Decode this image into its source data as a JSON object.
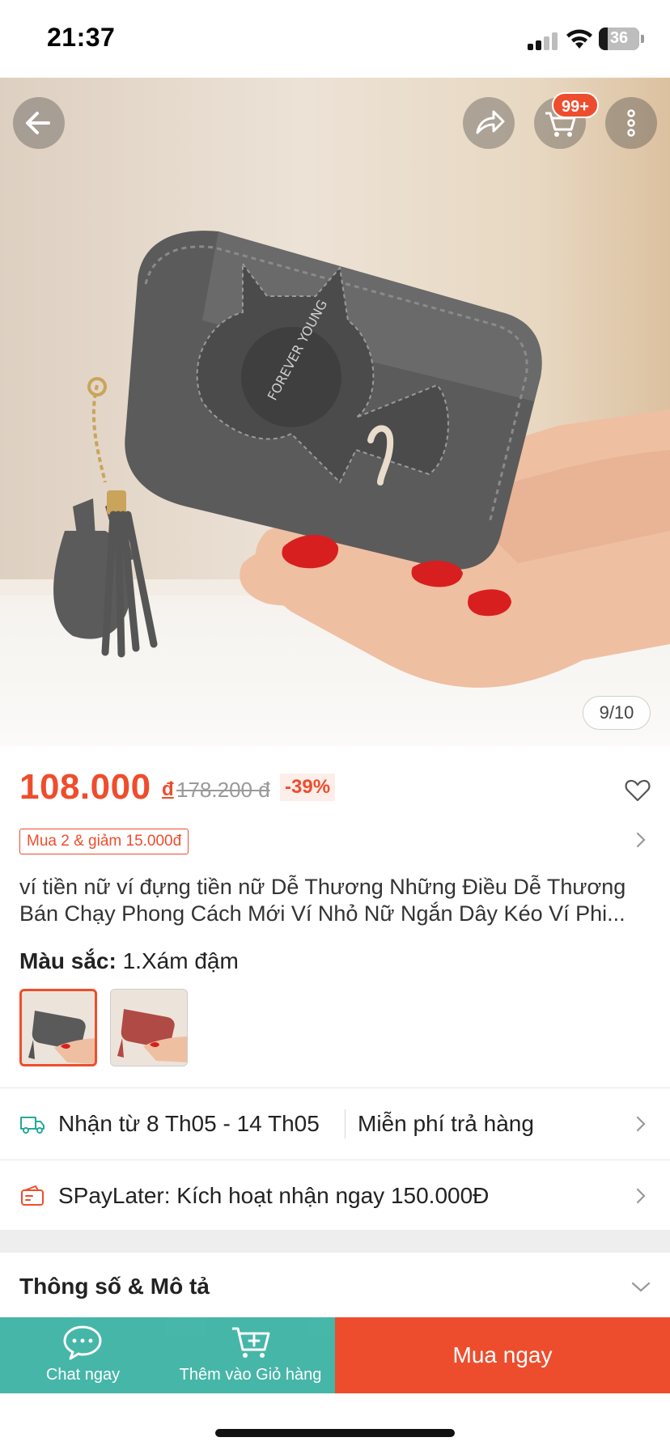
{
  "status_bar": {
    "time": "21:37",
    "battery": "36"
  },
  "product_image": {
    "counter": "9/10",
    "cart_badge": "99+",
    "icons": [
      "back-arrow-icon",
      "share-icon",
      "cart-icon",
      "more-vertical-icon"
    ]
  },
  "price": {
    "current": "108.000",
    "currency": "đ",
    "original": "178.200 đ",
    "discount": "-39%"
  },
  "voucher": {
    "label": "Mua 2 & giảm 15.000đ"
  },
  "title": {
    "line1": "ví tiền nữ ví đựng tiền nữ Dễ Thương Những Điều Dễ Thương",
    "line2": "Bán Chạy Phong Cách Mới Ví Nhỏ Nữ Ngắn Dây Kéo Ví Phi..."
  },
  "variant": {
    "label": "Màu sắc:",
    "selected": "1.Xám đậm",
    "options": [
      {
        "name": "1.Xám đậm",
        "swatch": "#5a5a5a"
      },
      {
        "name": "",
        "swatch": "#b04a45"
      }
    ]
  },
  "shipping": {
    "delivery": "Nhận từ 8 Th05 - 14 Th05",
    "returns": "Miễn phí trả hàng"
  },
  "paylater": {
    "text": "SPayLater: Kích hoạt nhận ngay 150.000Đ"
  },
  "specs": {
    "title": "Thông số & Mô tả"
  },
  "bottom_bar": {
    "chat": "Chat ngay",
    "add_to_cart": "Thêm vào Giỏ hàng",
    "buy_now": "Mua ngay"
  },
  "colors": {
    "accent": "#ee4d2d",
    "teal": "#26aa99"
  }
}
